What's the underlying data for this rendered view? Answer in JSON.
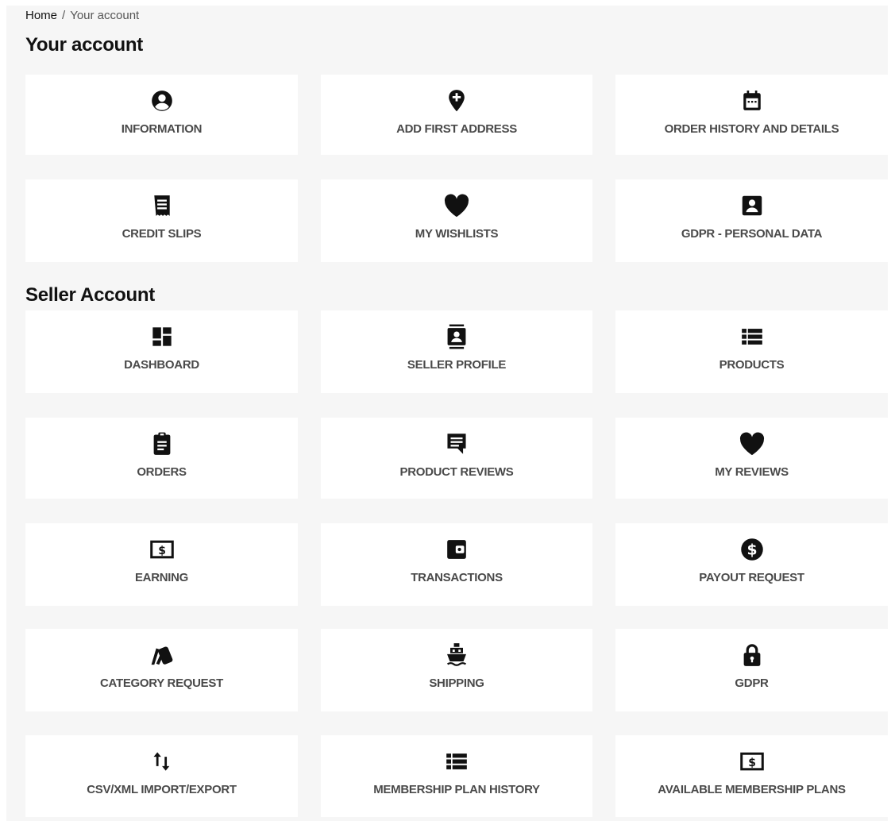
{
  "breadcrumb": {
    "home": "Home",
    "separator": "/",
    "current": "Your account"
  },
  "sections": {
    "account_title": "Your account",
    "seller_title": "Seller Account"
  },
  "account_tiles": [
    {
      "label": "INFORMATION",
      "icon": "user-circle-icon"
    },
    {
      "label": "ADD FIRST ADDRESS",
      "icon": "add-location-icon"
    },
    {
      "label": "ORDER HISTORY AND DETAILS",
      "icon": "calendar-icon"
    },
    {
      "label": "CREDIT SLIPS",
      "icon": "receipt-icon"
    },
    {
      "label": "MY WISHLISTS",
      "icon": "heart-icon"
    },
    {
      "label": "GDPR - PERSONAL DATA",
      "icon": "person-card-icon"
    }
  ],
  "seller_tiles": [
    {
      "label": "DASHBOARD",
      "icon": "dashboard-icon"
    },
    {
      "label": "SELLER PROFILE",
      "icon": "contact-book-icon"
    },
    {
      "label": "PRODUCTS",
      "icon": "list-icon"
    },
    {
      "label": "ORDERS",
      "icon": "clipboard-icon"
    },
    {
      "label": "PRODUCT REVIEWS",
      "icon": "comment-icon"
    },
    {
      "label": "MY REVIEWS",
      "icon": "heart-icon"
    },
    {
      "label": "EARNING",
      "icon": "money-icon"
    },
    {
      "label": "TRANSACTIONS",
      "icon": "wallet-icon"
    },
    {
      "label": "PAYOUT REQUEST",
      "icon": "dollar-circle-icon"
    },
    {
      "label": "CATEGORY REQUEST",
      "icon": "swatch-icon"
    },
    {
      "label": "SHIPPING",
      "icon": "ship-icon"
    },
    {
      "label": "GDPR",
      "icon": "lock-icon"
    },
    {
      "label": "CSV/XML IMPORT/EXPORT",
      "icon": "import-export-icon"
    },
    {
      "label": "MEMBERSHIP PLAN HISTORY",
      "icon": "list-icon"
    },
    {
      "label": "AVAILABLE MEMBERSHIP PLANS",
      "icon": "money-icon"
    }
  ]
}
